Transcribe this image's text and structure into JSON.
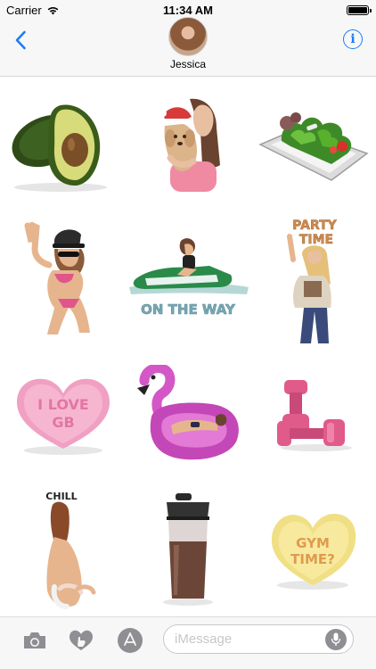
{
  "status_bar": {
    "carrier": "Carrier",
    "time": "11:34 AM",
    "battery_level": 1.0
  },
  "nav": {
    "back_icon": "chevron-left-icon",
    "contact_name": "Jessica",
    "info_icon": "info-icon",
    "info_glyph": "i"
  },
  "stickers": {
    "avocado": {
      "icon": "avocado-sticker"
    },
    "puppy_selfie": {
      "icon": "christmas-puppy-sticker"
    },
    "salad": {
      "icon": "salad-bowl-sticker"
    },
    "peace_sign": {
      "icon": "peace-sign-bikini-sticker"
    },
    "jet_ski": {
      "icon": "jet-ski-sticker",
      "text": "ON THE WAY"
    },
    "party_time": {
      "icon": "party-time-sticker",
      "text_line1": "PARTY",
      "text_line2": "TIME"
    },
    "candy_heart_love": {
      "icon": "candy-heart-sticker",
      "text_line1": "I LOVE",
      "text_line2": "GB"
    },
    "flamingo": {
      "icon": "flamingo-float-sticker"
    },
    "dumbbells": {
      "icon": "pink-dumbbells-sticker"
    },
    "chill": {
      "icon": "chill-sticker",
      "text": "CHILL"
    },
    "shaker": {
      "icon": "protein-shaker-sticker"
    },
    "candy_heart_gym": {
      "icon": "candy-heart-sticker",
      "text_line1": "GYM",
      "text_line2": "TIME?"
    }
  },
  "input_bar": {
    "camera_icon": "camera-icon",
    "digital_touch_icon": "heart-hand-icon",
    "app_store_icon": "app-store-icon",
    "placeholder": "iMessage",
    "mic_icon": "microphone-icon"
  },
  "colors": {
    "ios_blue": "#1a7ef5",
    "toolbar_grey": "#8e8e93",
    "bar_background": "#f7f7f7"
  }
}
